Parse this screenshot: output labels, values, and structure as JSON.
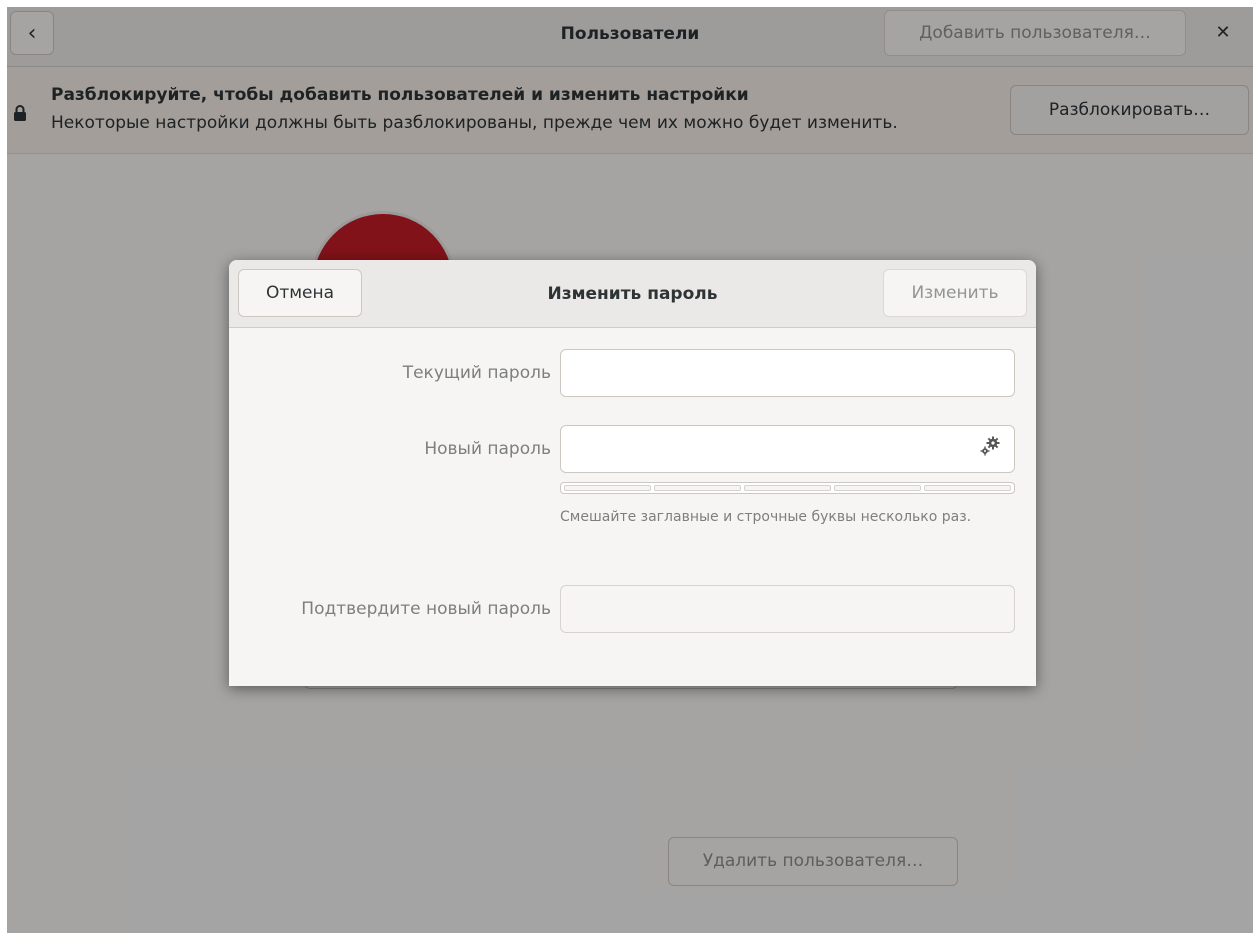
{
  "window": {
    "title": "Пользователи",
    "add_user_label": "Добавить пользователя…",
    "back_icon": "chevron-left-icon",
    "close_icon": "close-icon"
  },
  "infobar": {
    "title": "Разблокируйте, чтобы добавить пользователей и изменить настройки",
    "subtitle": "Некоторые настройки должны быть разблокированы, прежде чем их можно будет изменить.",
    "unlock_label": "Разблокировать…",
    "icon": "lock-icon"
  },
  "background": {
    "delete_user_label": "Удалить пользователя…",
    "avatar_color": "#c01c28"
  },
  "dialog": {
    "title": "Изменить пароль",
    "cancel_label": "Отмена",
    "change_label": "Изменить",
    "current_password_label": "Текущий пароль",
    "current_password_value": "",
    "new_password_label": "Новый пароль",
    "new_password_value": "",
    "generate_icon": "gears-icon",
    "strength_level": 0,
    "hint": "Смешайте заглавные и строчные буквы несколько раз.",
    "confirm_password_label": "Подтвердите новый пароль",
    "confirm_password_value": ""
  }
}
